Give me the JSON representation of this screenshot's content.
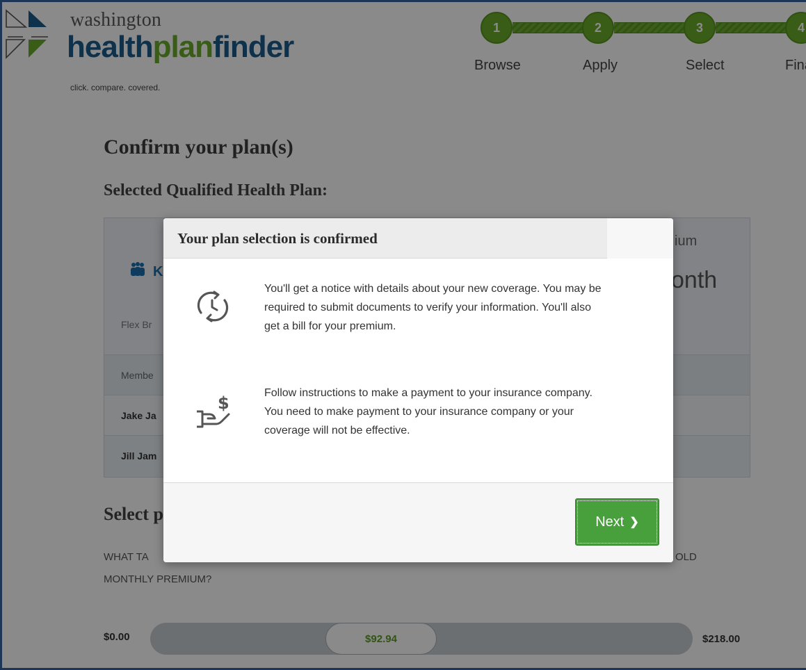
{
  "header": {
    "logo_top": "washington",
    "logo_word_1": "health",
    "logo_word_2": "plan",
    "logo_word_3": "finder",
    "tagline": "click. compare. covered."
  },
  "stepper": {
    "steps": [
      {
        "number": "1",
        "label": "Browse"
      },
      {
        "number": "2",
        "label": "Apply"
      },
      {
        "number": "3",
        "label": "Select"
      },
      {
        "number": "4",
        "label": "Fina"
      }
    ]
  },
  "page": {
    "title": "Confirm your plan(s)",
    "subtitle": "Selected Qualified Health Plan:",
    "plan_name_visible": "K",
    "plan_meta_visible": "Flex Br",
    "premium_label_visible": "ium",
    "premium_value_visible": "onth",
    "member_header_visible": "Membe",
    "member_1_visible": "Jake Ja",
    "member_2_visible": "Jill Jam",
    "payment_title_visible": "Select p",
    "payment_question_line1_start": "WHAT TA",
    "payment_question_line1_end": "OLD",
    "payment_question_line2": "MONTHLY PREMIUM?",
    "slider": {
      "min_label": "$0.00",
      "max_label": "$218.00",
      "current_label": "$92.94",
      "fraction": 0.426
    }
  },
  "modal": {
    "title": "Your plan selection is confirmed",
    "items": [
      {
        "icon": "clock-refresh-icon",
        "text": "You'll get a notice with details about your new coverage. You may be required to submit documents to verify your information. You'll also get a bill for your premium."
      },
      {
        "icon": "hand-dollar-icon",
        "text": "Follow instructions to make a payment to your insurance company. You need to make payment to your insurance company or your coverage will not be effective."
      }
    ],
    "next_label": "Next"
  },
  "colors": {
    "brand_blue": "#1a5b8c",
    "brand_green": "#6aaa2a",
    "button_green": "#47a03b",
    "frame_border": "#1d3557"
  }
}
